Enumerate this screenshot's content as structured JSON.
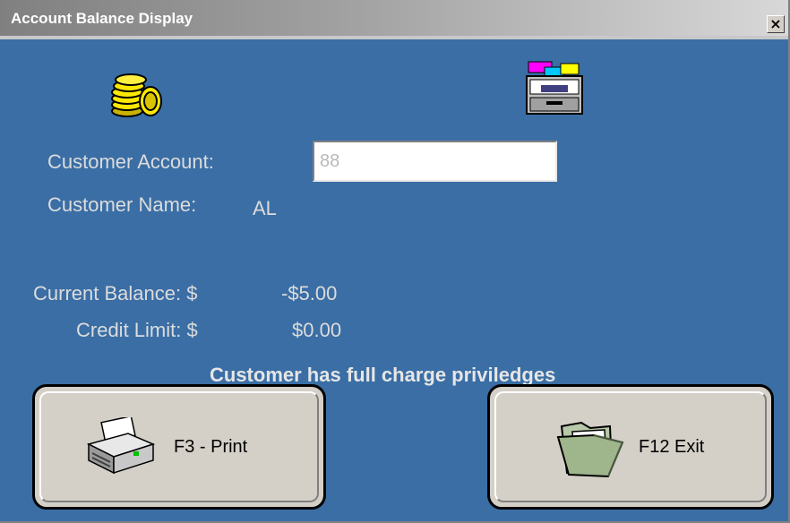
{
  "window": {
    "title": "Account Balance Display",
    "close_glyph": "×"
  },
  "icons": {
    "top_left": "coins-icon",
    "top_right": "file-cabinet-icon",
    "print": "printer-icon",
    "exit": "folder-icon"
  },
  "customer": {
    "account_label": "Customer Account:",
    "account_value": "88",
    "name_label": "Customer Name:",
    "name_value": "AL"
  },
  "balance": {
    "current_label": "Current Balance: $",
    "current_value": "-$5.00",
    "credit_label": "Credit Limit: $",
    "credit_value": "$0.00"
  },
  "notice": "Customer has full charge priviledges",
  "buttons": {
    "print_label": "F3 - Print",
    "exit_label": "F12 Exit"
  },
  "colors": {
    "background": "#3a6ea5",
    "label_text": "#dcdcdc",
    "button_face": "#d4d0c8"
  }
}
